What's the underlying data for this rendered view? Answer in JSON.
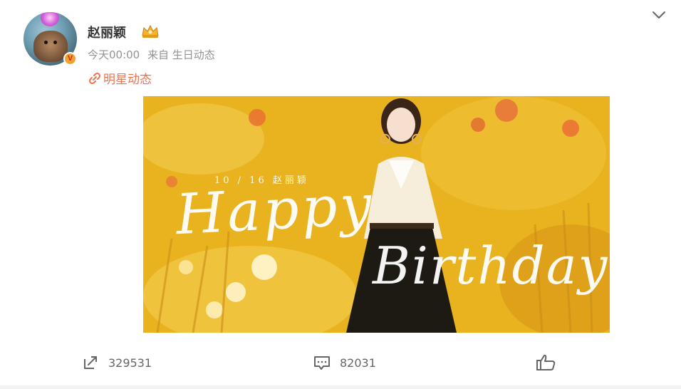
{
  "post": {
    "username": "赵丽颖",
    "timestamp": "今天00:00",
    "source": "来自 生日动态",
    "topic": "明星动态",
    "verified_badge_letter": "V",
    "image": {
      "date_text": "10 / 16  赵丽颖",
      "happy_text": "Happy",
      "birthday_text": "Birthday"
    }
  },
  "actions": {
    "repost_count": "329531",
    "comment_count": "82031",
    "like_count": ""
  },
  "icons": {
    "more": "chevron-down-icon",
    "crown": "crown-badge-icon",
    "topic": "link-icon",
    "repost": "repost-icon",
    "comment": "comment-icon",
    "like": "like-icon"
  },
  "colors": {
    "topic": "#eb7350",
    "text_primary": "#333333",
    "text_secondary": "#939393",
    "action_text": "#666666",
    "badge": "#f0a22f"
  }
}
